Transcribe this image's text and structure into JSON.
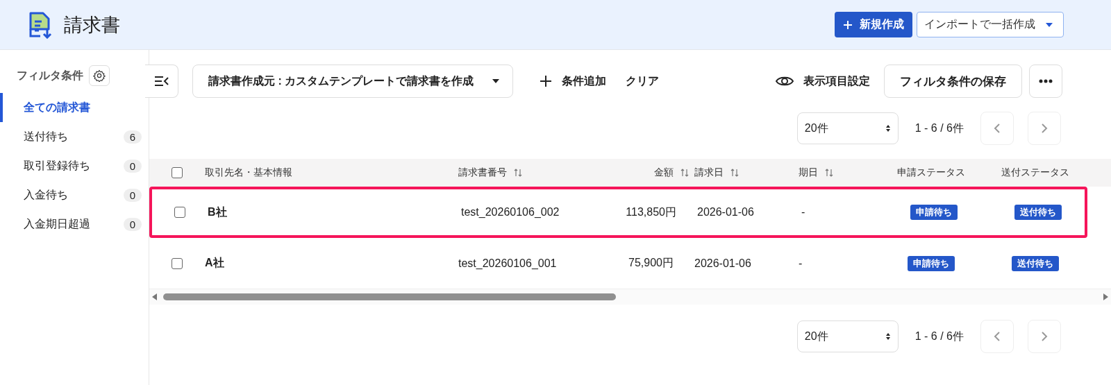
{
  "header": {
    "title": "請求書",
    "new_button": "新規作成",
    "import_button": "インポートで一括作成"
  },
  "sidebar": {
    "heading": "フィルタ条件",
    "items": [
      {
        "label": "全ての請求書",
        "selected": true
      },
      {
        "label": "送付待ち",
        "count": "6",
        "selected": false
      },
      {
        "label": "取引登録待ち",
        "count": "0",
        "selected": false
      },
      {
        "label": "入金待ち",
        "count": "0",
        "selected": false
      },
      {
        "label": "入金期日超過",
        "count": "0",
        "selected": false
      }
    ]
  },
  "toolbar": {
    "filter": "請求書作成元 : カスタムテンプレートで請求書を作成",
    "add_condition": "条件追加",
    "clear": "クリア",
    "display_settings": "表示項目設定",
    "save_filter": "フィルタ条件の保存"
  },
  "pagination_top": {
    "per_page": "20件",
    "range": "1 - 6 / 6件"
  },
  "table": {
    "select_all_checked": false,
    "columns": [
      {
        "label": "取引先名・基本情報",
        "sortable": false
      },
      {
        "label": "請求書番号",
        "sortable": true
      },
      {
        "label": "金額",
        "sortable": true
      },
      {
        "label": "請求日",
        "sortable": true
      },
      {
        "label": "期日",
        "sortable": true
      },
      {
        "label": "申請ステータス",
        "sortable": false
      },
      {
        "label": "送付ステータス",
        "sortable": false
      }
    ],
    "rows": [
      {
        "checked": false,
        "highlighted": true,
        "cells": [
          "B社",
          "test_20260106_002",
          "113,850円",
          "2026-01-06",
          "-",
          "申請待ち",
          "送付待ち"
        ]
      },
      {
        "checked": false,
        "highlighted": false,
        "cells": [
          "A社",
          "test_20260106_001",
          "75,900円",
          "2026-01-06",
          "-",
          "申請待ち",
          "送付待ち"
        ]
      }
    ]
  },
  "pagination_bottom": {
    "per_page": "20件",
    "range": "1 - 6 / 6件"
  }
}
